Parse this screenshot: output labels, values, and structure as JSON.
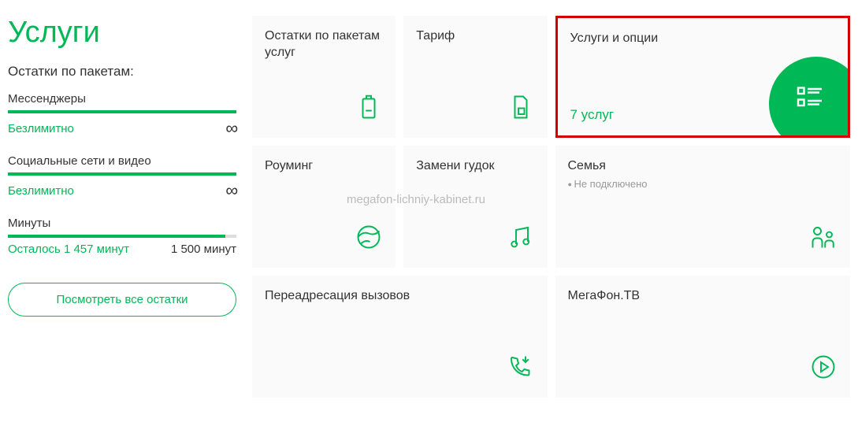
{
  "sidebar": {
    "title": "Услуги",
    "subtitle": "Остатки по пакетам:",
    "items": [
      {
        "label": "Мессенджеры",
        "value": "Безлимитно",
        "unlimited": true,
        "fill": 100
      },
      {
        "label": "Социальные сети и видео",
        "value": "Безлимитно",
        "unlimited": true,
        "fill": 100
      },
      {
        "label": "Минуты",
        "value": "Осталось 1 457 минут",
        "total": "1 500 минут",
        "unlimited": false,
        "fill": 95
      }
    ],
    "button": "Посмотреть все остатки"
  },
  "cards": {
    "packages": {
      "title": "Остатки по пакетам услуг"
    },
    "tariff": {
      "title": "Тариф"
    },
    "services": {
      "title": "Услуги и опции",
      "value": "7 услуг"
    },
    "roaming": {
      "title": "Роуминг"
    },
    "ringtone": {
      "title": "Замени гудок"
    },
    "family": {
      "title": "Семья",
      "sub": "Не подключено"
    },
    "forwarding": {
      "title": "Переадресация вызовов"
    },
    "tv": {
      "title": "МегаФон.ТВ"
    }
  },
  "watermark": "megafon-lichniy-kabinet.ru"
}
